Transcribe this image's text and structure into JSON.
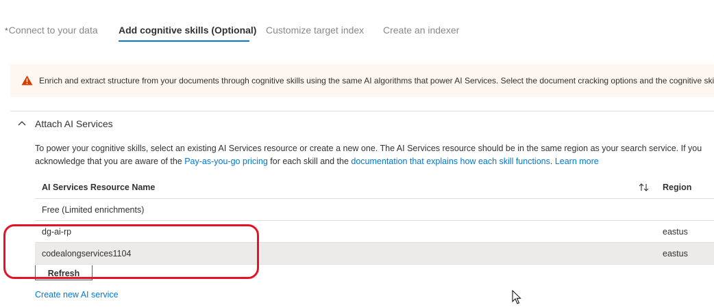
{
  "wizard": {
    "required_mark": "*",
    "tabs": [
      {
        "label": "Connect to your data"
      },
      {
        "label": "Add cognitive skills (Optional)"
      },
      {
        "label": "Customize target index"
      },
      {
        "label": "Create an indexer"
      }
    ]
  },
  "banner": {
    "icon": "warning-triangle-icon",
    "text": "Enrich and extract structure from your documents through cognitive skills using the same AI algorithms that power AI Services. Select the document cracking options and the cognitive skills"
  },
  "section": {
    "title": "Attach AI Services",
    "description_part1": "To power your cognitive skills, select an existing AI Services resource or create a new one. The AI Services resource should be in the same region as your search service. If you",
    "description_part2": "acknowledge that you are aware of the ",
    "link_pricing": "Pay-as-you-go pricing",
    "description_part3": " for each skill and the ",
    "link_docs": "documentation that explains how each skill functions",
    "description_part4": ". ",
    "link_learn": "Learn more"
  },
  "grid": {
    "col_name": "AI Services Resource Name",
    "col_region": "Region",
    "rows": [
      {
        "name": "Free (Limited enrichments)",
        "region": ""
      },
      {
        "name": "dg-ai-rp",
        "region": "eastus"
      },
      {
        "name": "codealongservices1104",
        "region": "eastus"
      }
    ]
  },
  "actions": {
    "refresh_label": "Refresh",
    "create_label": "Create new AI service"
  },
  "colors": {
    "accent": "#0078d4",
    "warning": "#d83b01",
    "annotation": "#e81123"
  }
}
